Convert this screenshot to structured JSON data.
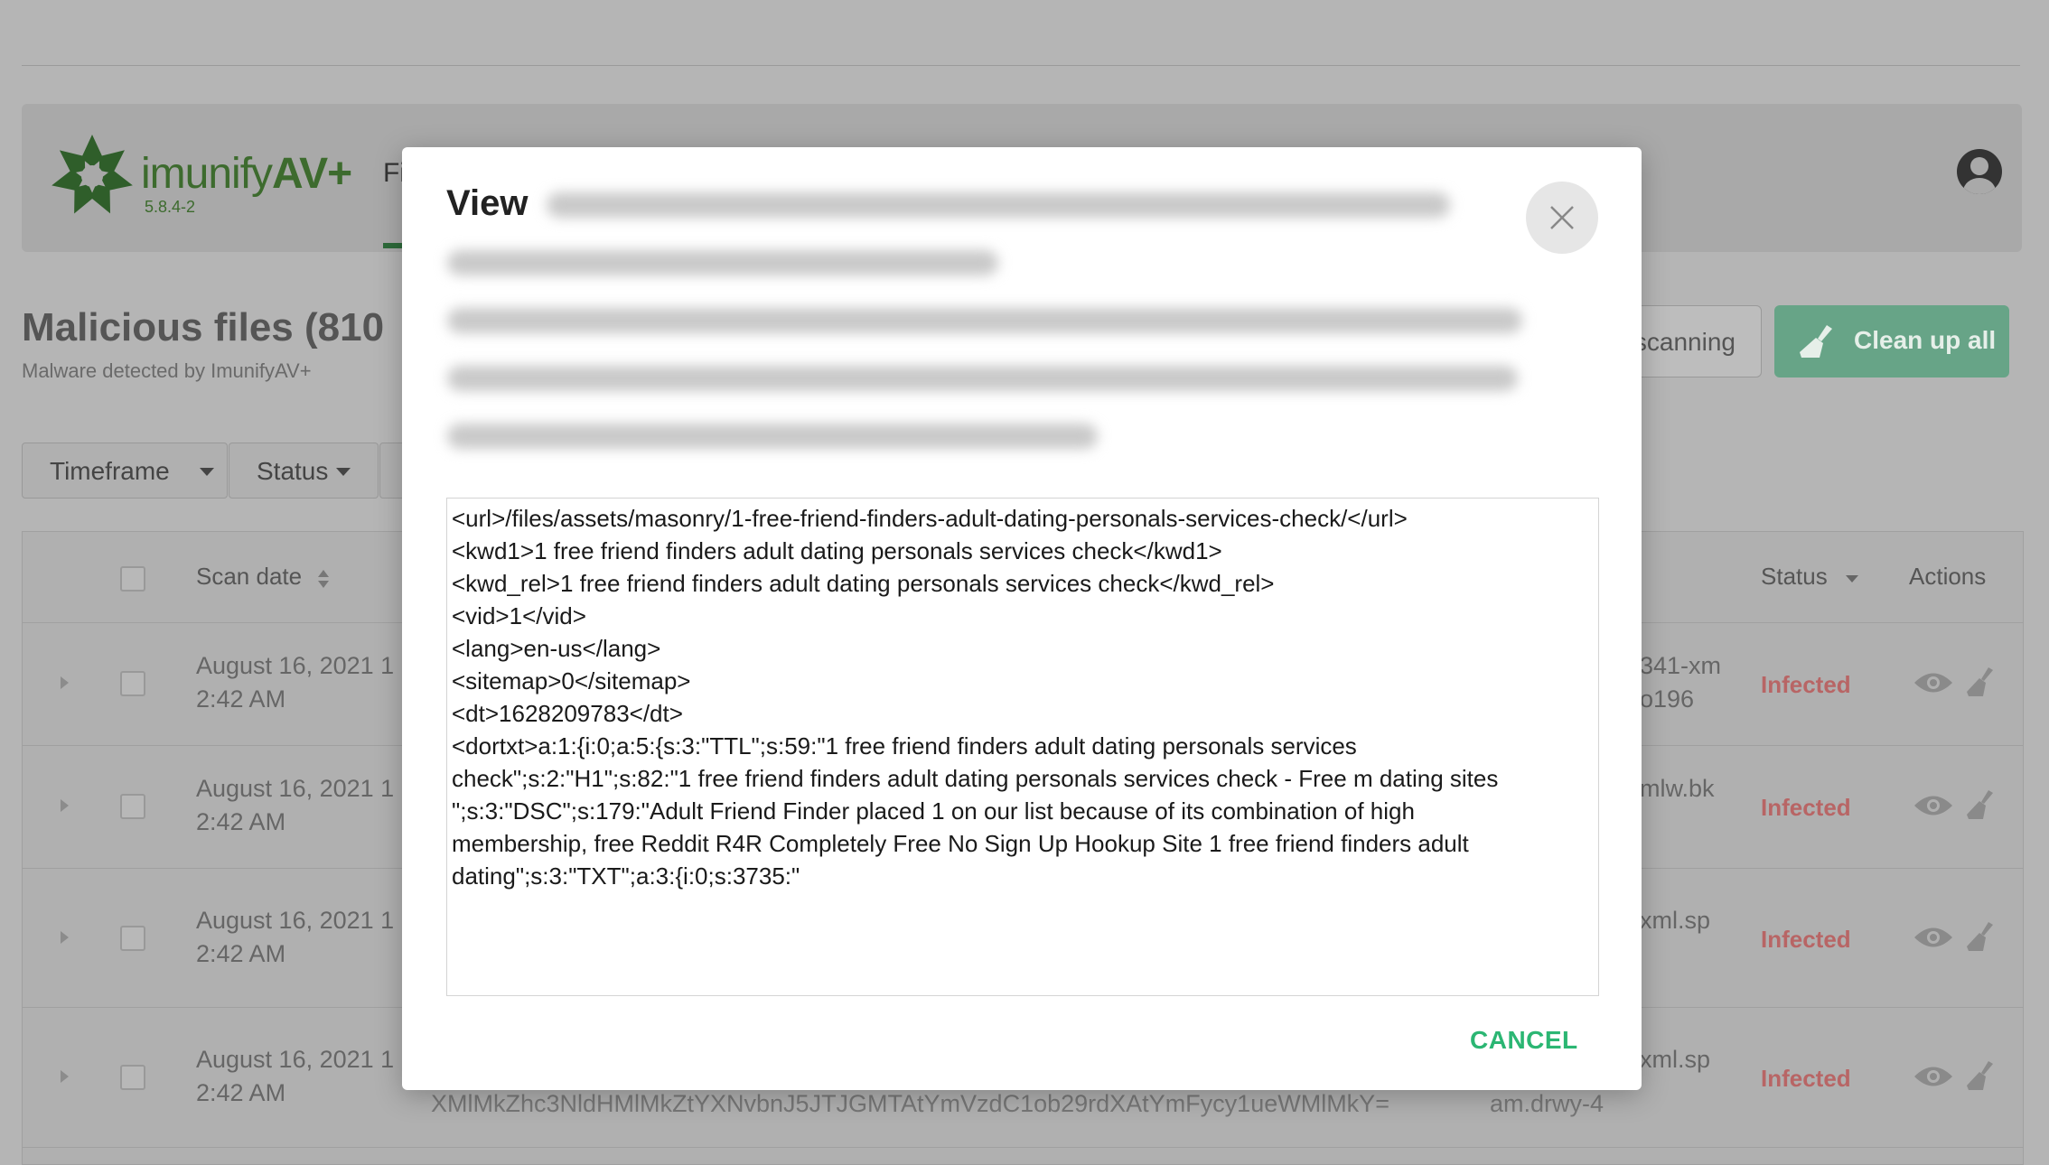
{
  "app": {
    "brand_prefix": "imunify",
    "brand_suffix": "AV+",
    "version": "5.8.4-2",
    "nav_tab_partial": "Fi"
  },
  "page": {
    "title": "Malicious files (810",
    "subtitle": "Malware detected by ImunifyAV+",
    "scanning_button": "scanning",
    "clean_up_all_button": "Clean up all"
  },
  "filters": {
    "timeframe": "Timeframe",
    "status": "Status"
  },
  "table": {
    "headers": {
      "scan_date": "Scan date",
      "status": "Status",
      "actions": "Actions"
    },
    "rows": [
      {
        "date_line1": "August 16, 2021 1",
        "date_line2": "2:42 AM",
        "file_line1": "341-xm",
        "file_line2": "o196",
        "status": "Infected"
      },
      {
        "date_line1": "August 16, 2021 1",
        "date_line2": "2:42 AM",
        "file_line1": "mlw.bk",
        "file_line2": "",
        "status": "Infected"
      },
      {
        "date_line1": "August 16, 2021 1",
        "date_line2": "2:42 AM",
        "file_line1": "xml.sp",
        "file_line2": "",
        "status": "Infected"
      },
      {
        "date_line1": "August 16, 2021 1",
        "date_line2": "2:42 AM",
        "file_line1": "xml.sp",
        "file_line2": "",
        "status": "Infected",
        "hash": "XMlMkZhc3NldHMlMkZtYXNvbnJ5JTJGMTAtYmVzdC1ob29rdXAtYmFycy1ueWMlMkY=",
        "file_alt": "am.drwy-4"
      }
    ]
  },
  "modal": {
    "title": "View",
    "content_lines": [
      "<url>/files/assets/masonry/1-free-friend-finders-adult-dating-personals-services-check/</url>",
      "<kwd1>1 free friend finders adult dating personals services check</kwd1>",
      "<kwd_rel>1 free friend finders adult dating personals services check</kwd_rel>",
      "<vid>1</vid>",
      "<lang>en-us</lang>",
      "<sitemap>0</sitemap>",
      "<dt>1628209783</dt>",
      "<dortxt>a:1:{i:0;a:5:{s:3:\"TTL\";s:59:\"1 free friend finders adult dating personals services",
      "check\";s:2:\"H1\";s:82:\"1 free friend finders adult dating personals services check - Free m dating sites",
      "\";s:3:\"DSC\";s:179:\"Adult Friend Finder placed 1 on our list because of its combination of high",
      "membership, free  Reddit R4R  Completely Free No Sign Up Hookup Site 1 free friend finders adult",
      "dating\";s:3:\"TXT\";a:3:{i:0;s:3735:\""
    ],
    "cancel_button": "CANCEL"
  },
  "icons": {
    "close": "close-icon",
    "eye": "eye-icon",
    "broom": "broom-icon",
    "avatar": "user-avatar-icon",
    "logo": "imunify-logo-icon"
  },
  "colors": {
    "accent_green": "#2bb673",
    "brand_green": "#3d6b2e",
    "infected_red": "#b86565"
  }
}
